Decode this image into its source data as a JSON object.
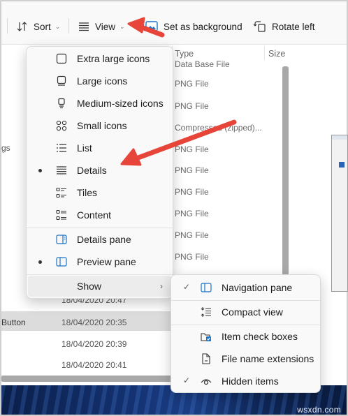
{
  "toolbar": {
    "sort_label": "Sort",
    "view_label": "View",
    "set_background_label": "Set as background",
    "rotate_left_label": "Rotate left"
  },
  "file_list": {
    "column_type": "Type",
    "column_size": "Size",
    "left_truncated_text": "gs",
    "type_rows": [
      "Data Base File",
      "PNG File",
      "PNG File",
      "Compressed (zipped)...",
      "PNG File",
      "PNG File",
      "PNG File",
      "PNG File",
      "PNG File",
      "PNG File"
    ],
    "date_rows": [
      {
        "name": "",
        "date": "18/04/2020 20:47"
      },
      {
        "name": "Button",
        "date": "18/04/2020 20:35"
      },
      {
        "name": "",
        "date": "18/04/2020 20:39"
      },
      {
        "name": "",
        "date": "18/04/2020 20:41"
      }
    ]
  },
  "view_menu": {
    "items": [
      {
        "label": "Extra large icons",
        "icon": "extra-large-icons-icon",
        "selected": false
      },
      {
        "label": "Large icons",
        "icon": "large-icons-icon",
        "selected": false
      },
      {
        "label": "Medium-sized icons",
        "icon": "medium-icons-icon",
        "selected": false
      },
      {
        "label": "Small icons",
        "icon": "small-icons-icon",
        "selected": false
      },
      {
        "label": "List",
        "icon": "list-icon",
        "selected": false
      },
      {
        "label": "Details",
        "icon": "details-icon",
        "selected": true
      },
      {
        "label": "Tiles",
        "icon": "tiles-icon",
        "selected": false
      },
      {
        "label": "Content",
        "icon": "content-icon",
        "selected": false
      }
    ],
    "pane_items": [
      {
        "label": "Details pane",
        "icon": "details-pane-icon",
        "selected": false
      },
      {
        "label": "Preview pane",
        "icon": "preview-pane-icon",
        "selected": true
      }
    ],
    "show_label": "Show"
  },
  "show_menu": {
    "items": [
      {
        "label": "Navigation pane",
        "icon": "navigation-pane-icon",
        "checked": true
      },
      {
        "label": "Compact view",
        "icon": "compact-view-icon",
        "checked": false
      },
      {
        "label": "Item check boxes",
        "icon": "item-check-boxes-icon",
        "checked": false
      },
      {
        "label": "File name extensions",
        "icon": "file-extension-icon",
        "checked": false
      },
      {
        "label": "Hidden items",
        "icon": "hidden-items-icon",
        "checked": true
      }
    ]
  },
  "watermark": "wsxdn.com",
  "colors": {
    "accent_arrow": "#e8453a",
    "accent_blue": "#1a73c8",
    "menu_bg": "#f9f9f9"
  }
}
